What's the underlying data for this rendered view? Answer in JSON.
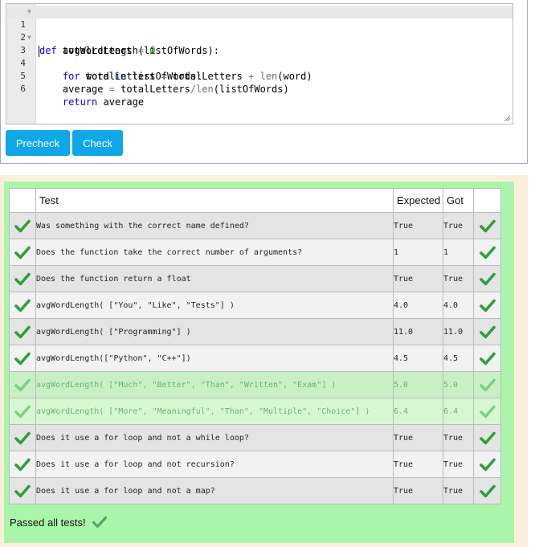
{
  "editor": {
    "lines": [
      {
        "n": "1",
        "fold": true
      },
      {
        "n": "2",
        "fold": false
      },
      {
        "n": "3",
        "fold": true
      },
      {
        "n": "4",
        "fold": false
      },
      {
        "n": "5",
        "fold": false
      },
      {
        "n": "6",
        "fold": false
      }
    ],
    "code": {
      "l1_kw": "def",
      "l1_rest": " avgWordLength(listOfWords):",
      "l2_a": "    totalLetters ",
      "l2_op": "=",
      "l2_num": " 0",
      "l3_kw1": "for",
      "l3_mid": " word ",
      "l3_kw2": "in",
      "l3_rest": " listOfWords:",
      "l4_a": "        totalLetters ",
      "l4_op1": "=",
      "l4_b": " totalLetters ",
      "l4_op2": "+",
      "l4_bi": " len",
      "l4_c": "(word)",
      "l5_a": "    average ",
      "l5_op1": "=",
      "l5_b": " totalLetters",
      "l5_op2": "/",
      "l5_bi": "len",
      "l5_c": "(listOfWords)",
      "l6_kw": "return",
      "l6_rest": " average"
    }
  },
  "buttons": {
    "precheck": "Precheck",
    "check": "Check"
  },
  "results": {
    "headers": {
      "test": "Test",
      "expected": "Expected",
      "got": "Got"
    },
    "rows": [
      {
        "test": "Was something with the correct name defined?",
        "expected": "True",
        "got": "True"
      },
      {
        "test": "Does the function take the correct number of arguments?",
        "expected": "1",
        "got": "1"
      },
      {
        "test": "Does the function return a float",
        "expected": "True",
        "got": "True"
      },
      {
        "test": "avgWordLength( [\"You\", \"Like\", \"Tests\"] )",
        "expected": "4.0",
        "got": "4.0"
      },
      {
        "test": "avgWordLength( [\"Programming\"] )",
        "expected": "11.0",
        "got": "11.0"
      },
      {
        "test": "avgWordLength([\"Python\", \"C++\"])",
        "expected": "4.5",
        "got": "4.5"
      },
      {
        "test": "avgWordLength( [\"Much\", \"Better\", \"Than\", \"Written\", \"Exam\"] )",
        "expected": "5.0",
        "got": "5.0"
      },
      {
        "test": "avgWordLength( [\"More\", \"Meaningful\", \"Than\", \"Multiple\", \"Choice\"] )",
        "expected": "6.4",
        "got": "6.4"
      },
      {
        "test": "Does it use a for loop and not a while loop?",
        "expected": "True",
        "got": "True"
      },
      {
        "test": "Does it use a for loop and not recursion?",
        "expected": "True",
        "got": "True"
      },
      {
        "test": "Does it use a for loop and not a map?",
        "expected": "True",
        "got": "True"
      }
    ],
    "summary": "Passed all tests!"
  },
  "colors": {
    "accent": "#0ea7e8",
    "pass_green": "#2e9e3a",
    "results_bg": "#aaf5a9"
  },
  "icons": {
    "pass": "check-icon"
  }
}
